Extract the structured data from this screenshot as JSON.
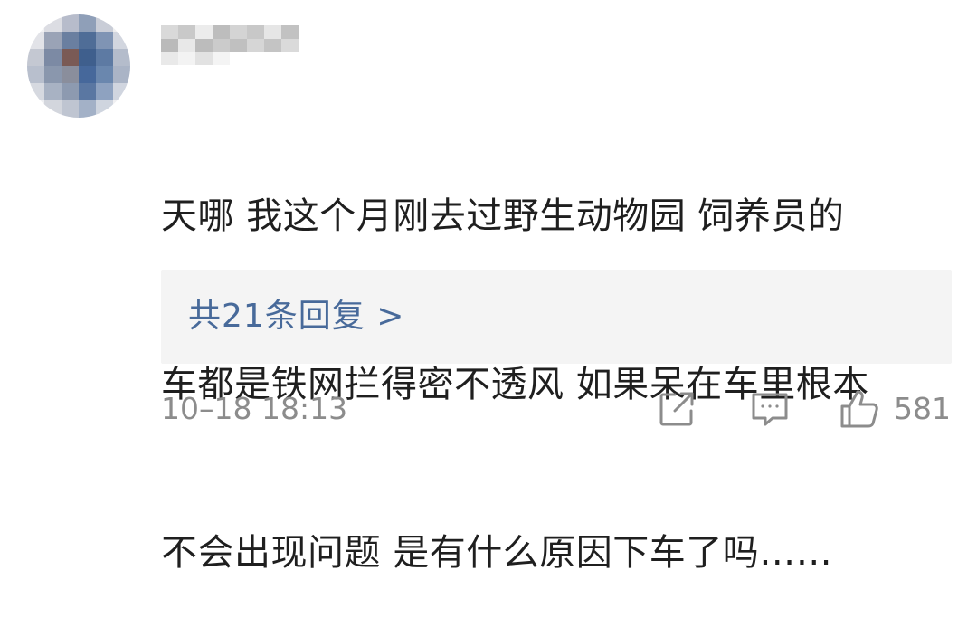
{
  "comment": {
    "lines": [
      "天哪 我这个月刚去过野生动物园 饲养员的",
      "车都是铁网拦得密不透风 如果呆在车里根本",
      "不会出现问题 是有什么原因下车了吗……"
    ]
  },
  "replies": {
    "label": "共21条回复 >"
  },
  "footer": {
    "timestamp": "10–18 18:13",
    "like_count": "581"
  },
  "icons": {
    "share": "share-icon",
    "comment": "comment-icon",
    "like": "thumbs-up-icon"
  },
  "colors": {
    "link": "#486a9a",
    "meta": "#8c8c8c",
    "text": "#1f1f1f",
    "reply_bg": "#f4f4f4"
  }
}
